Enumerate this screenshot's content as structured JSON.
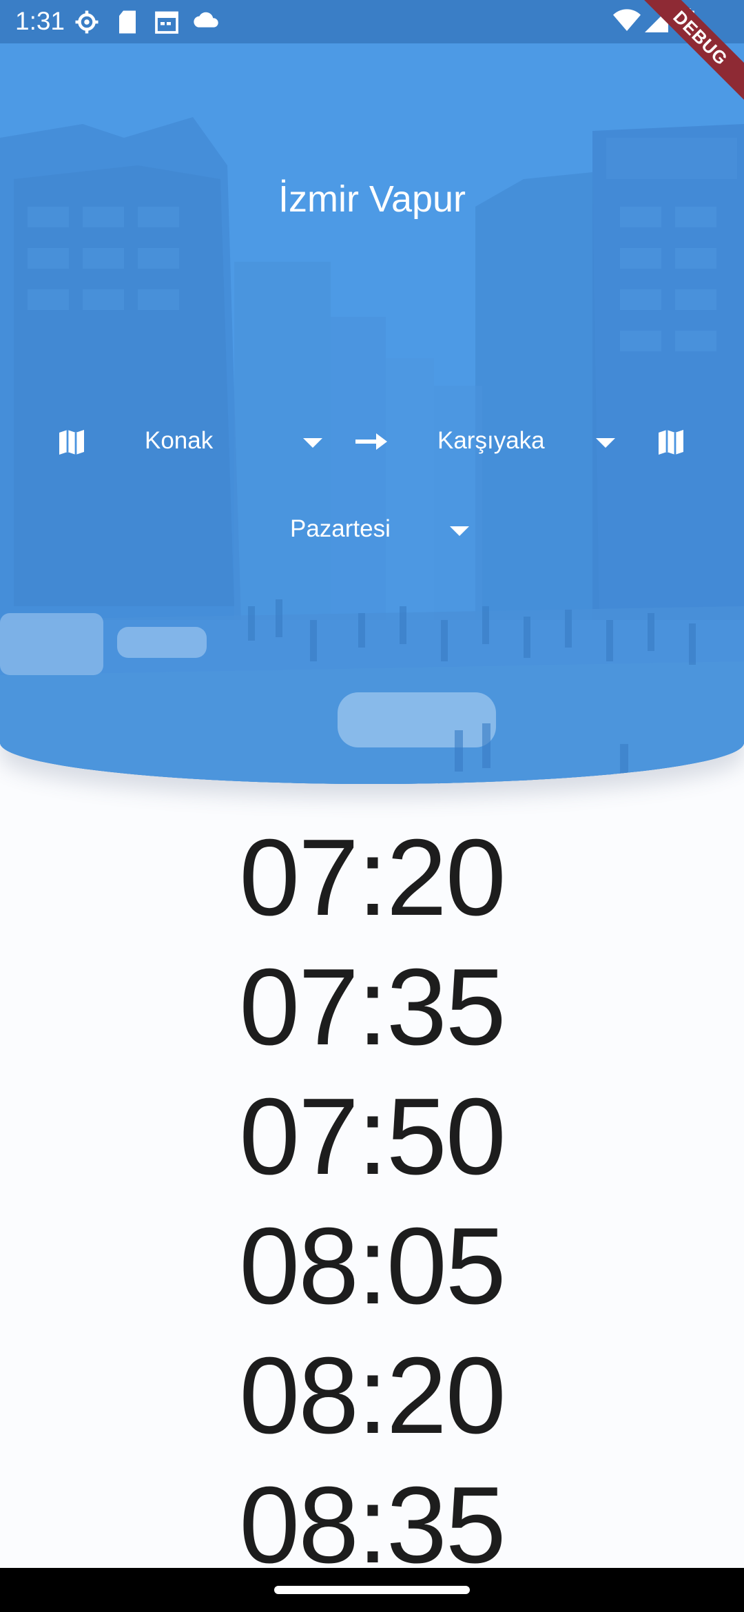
{
  "status_bar": {
    "time": "1:31",
    "left_icons": [
      "settings-gear-icon",
      "sd-card-icon",
      "calendar-icon",
      "cloud-icon"
    ],
    "right_icons": [
      "wifi-icon",
      "cellular-signal-icon",
      "battery-icon"
    ]
  },
  "debug_banner": "DEBUG",
  "header": {
    "title": "İzmir Vapur",
    "from_station": "Konak",
    "to_station": "Karşıyaka",
    "day": "Pazartesi",
    "colors": {
      "overlay": "#4a94e0",
      "text": "#ffffff"
    }
  },
  "departures": [
    "07:20",
    "07:35",
    "07:50",
    "08:05",
    "08:20",
    "08:35"
  ]
}
